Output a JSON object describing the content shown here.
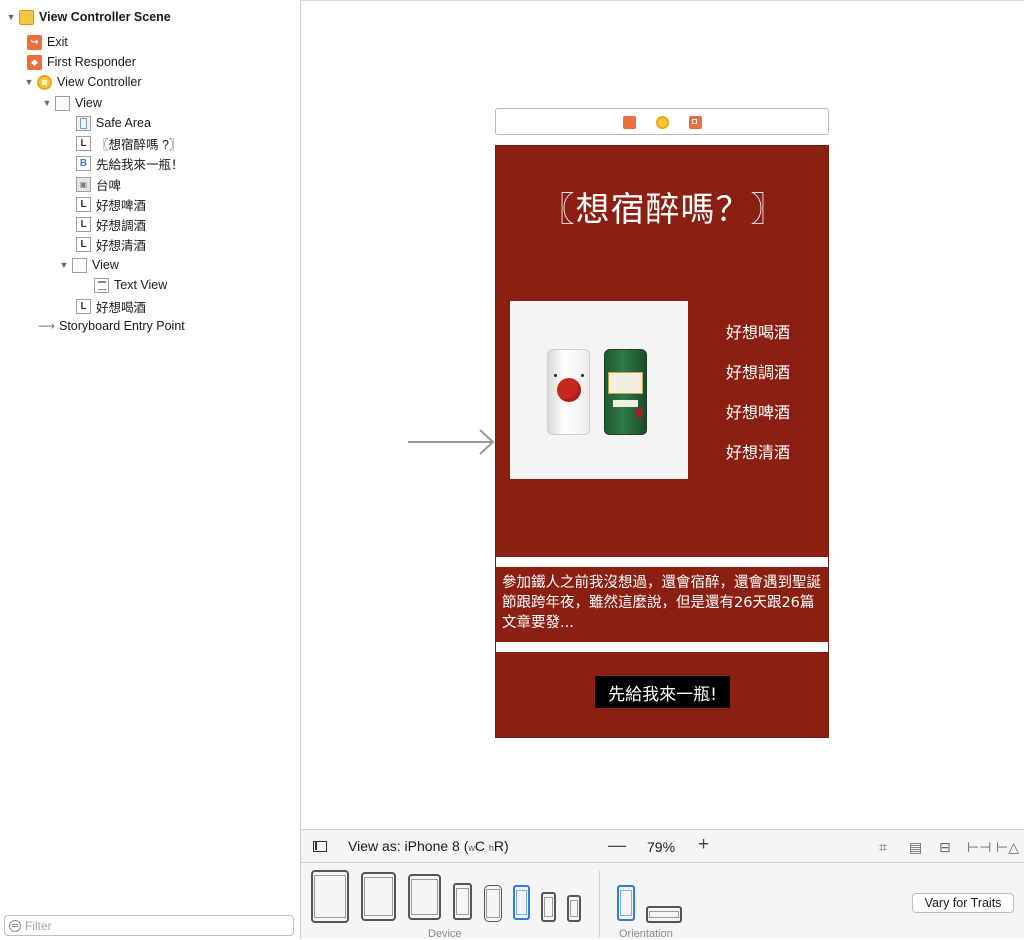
{
  "outline": {
    "items": [
      {
        "label": "View Controller Scene",
        "icon": "scene-icon"
      },
      {
        "label": "Exit",
        "icon": "exit-icon"
      },
      {
        "label": "First Responder",
        "icon": "first-responder-icon"
      },
      {
        "label": "View Controller",
        "icon": "view-controller-icon"
      },
      {
        "label": "View",
        "icon": "view-icon"
      },
      {
        "label": "Safe Area",
        "icon": "safe-area-icon"
      },
      {
        "label": "〖想宿醉嗎 ?〗",
        "icon": "label-icon",
        "badge": "L"
      },
      {
        "label": "先給我來一瓶！",
        "icon": "button-icon",
        "badge": "B"
      },
      {
        "label": "台啤",
        "icon": "image-view-icon"
      },
      {
        "label": "好想啤酒",
        "icon": "label-icon",
        "badge": "L"
      },
      {
        "label": "好想調酒",
        "icon": "label-icon",
        "badge": "L"
      },
      {
        "label": "好想清酒",
        "icon": "label-icon",
        "badge": "L"
      },
      {
        "label": "View",
        "icon": "view-icon"
      },
      {
        "label": "Text View",
        "icon": "text-view-icon"
      },
      {
        "label": "好想喝酒",
        "icon": "label-icon",
        "badge": "L"
      },
      {
        "label": "Storyboard Entry Point",
        "icon": "entry-arrow-icon"
      }
    ],
    "filter_placeholder": "Filter"
  },
  "screen": {
    "title": "〖想宿醉嗎？〗",
    "menu": [
      "好想喝酒",
      "好想調酒",
      "好想啤酒",
      "好想清酒"
    ],
    "text_view": "參加鐵人之前我沒想過，還會宿醉，還會遇到聖誕節跟跨年夜，雖然這麼說，但是還有26天跟26篇文章要發...",
    "button": "先給我來一瓶!",
    "background_color": "#8b1f12"
  },
  "viewas": {
    "prefix": "View as: iPhone 8 (",
    "w": "w",
    "c": "C",
    "h": "h",
    "r": "R)",
    "zoom_minus": "—",
    "zoom": "79%",
    "zoom_plus": "+"
  },
  "devices": {
    "device_caption": "Device",
    "orientation_caption": "Orientation",
    "vary_button": "Vary for Traits",
    "selected_device": "iPhone 8",
    "accent_color": "#2f7de1"
  }
}
